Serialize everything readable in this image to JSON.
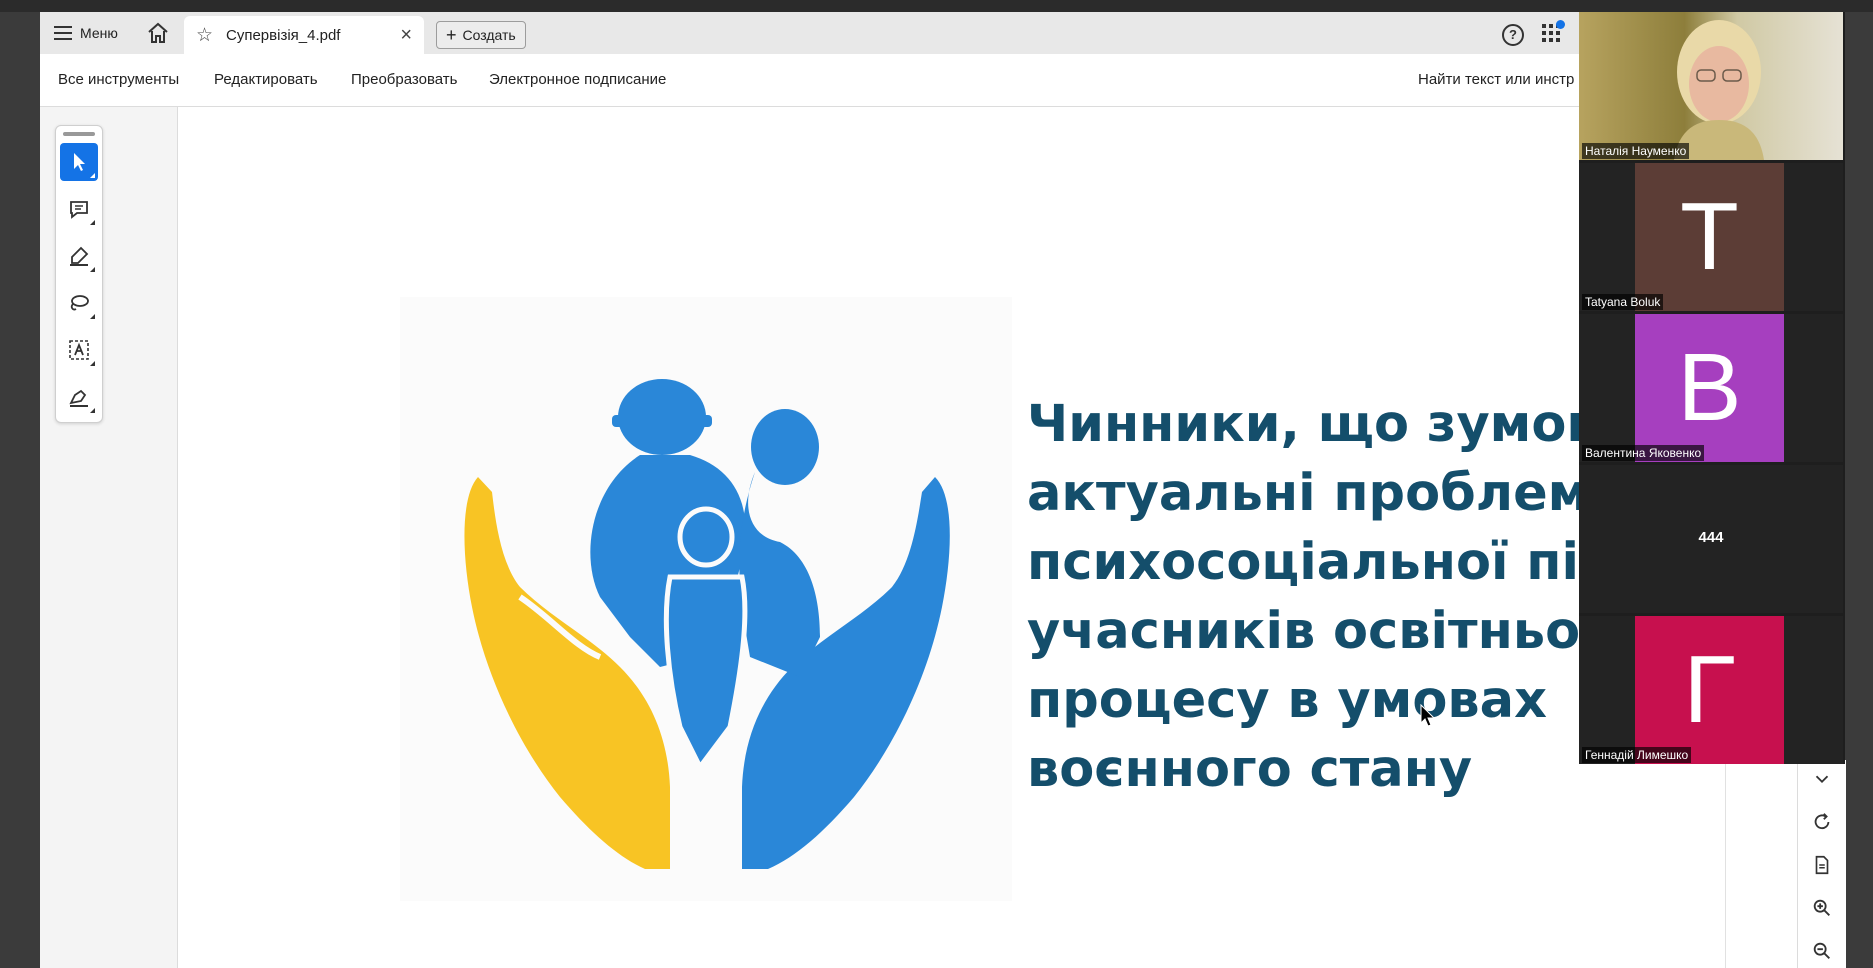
{
  "tabbar": {
    "menu_label": "Меню",
    "tab_title": "Супервізія_4.pdf",
    "close_glyph": "×",
    "create_label": "Создать",
    "plus_glyph": "+",
    "help_glyph": "?"
  },
  "toolbar": {
    "items": [
      "Все инструменты",
      "Редактировать",
      "Преобразовать",
      "Электронное подписание"
    ],
    "search_label": "Найти текст или инстр"
  },
  "slide": {
    "title_lines": [
      "Чинники, що зумовлюють",
      "актуальні проблеми",
      "психосоціальної підтримки",
      "учасників освітнього",
      "процесу в умовах",
      "воєнного стану"
    ]
  },
  "video_panel": {
    "tiles": [
      {
        "name": "Наталія Науменко",
        "type": "camera"
      },
      {
        "name": "Tatyana Boluk",
        "initial": "T",
        "color": "#5c3d36"
      },
      {
        "name": "Валентина Яковенко",
        "initial": "В",
        "color": "#a63fbf"
      },
      {
        "text": "444",
        "type": "text"
      },
      {
        "name": "Геннадій Лимешко",
        "initial": "Г",
        "color": "#c7104e"
      }
    ]
  },
  "colors": {
    "title": "#144e6b",
    "logo_blue": "#2a87d8",
    "logo_yellow": "#f8c424",
    "accent": "#1473e6"
  },
  "icons": [
    "hamburger-icon",
    "home-icon",
    "star-icon",
    "close-icon",
    "help-icon",
    "apps-icon",
    "select-arrow-icon",
    "comment-icon",
    "highlighter-icon",
    "lasso-icon",
    "text-select-icon",
    "sign-pen-icon",
    "chevron-down-icon",
    "rotate-icon",
    "page-icon",
    "zoom-in-icon",
    "zoom-out-icon"
  ]
}
